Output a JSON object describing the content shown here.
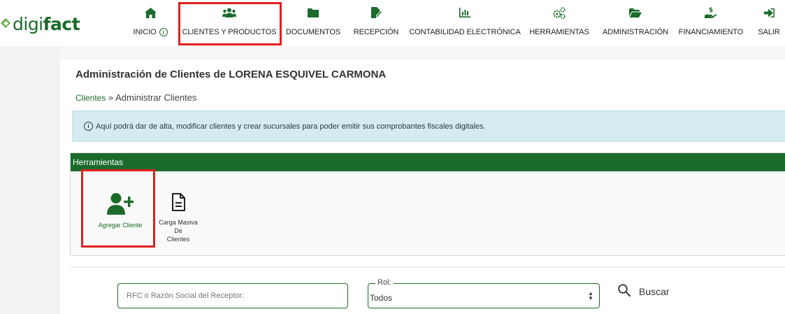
{
  "brand": {
    "part1": "digi",
    "part2": "fact"
  },
  "nav": [
    {
      "id": "inicio",
      "label": "INICIO",
      "icon": "home-icon"
    },
    {
      "id": "clientes",
      "label": "CLIENTES Y PRODUCTOS",
      "icon": "users-icon"
    },
    {
      "id": "documentos",
      "label": "DOCUMENTOS",
      "icon": "folder-icon"
    },
    {
      "id": "recepcion",
      "label": "RECEPCIÓN",
      "icon": "file-signature-icon"
    },
    {
      "id": "contabilidad",
      "label": "CONTABILIDAD ELECTRÓNICA",
      "icon": "chart-icon"
    },
    {
      "id": "herramientas",
      "label": "HERRAMIENTAS",
      "icon": "gears-icon"
    },
    {
      "id": "administracion",
      "label": "ADMINISTRACIÓN",
      "icon": "folder-open-icon"
    },
    {
      "id": "financiamiento",
      "label": "FINANCIAMIENTO",
      "icon": "hand-money-icon"
    },
    {
      "id": "salir",
      "label": "SALIR",
      "icon": "sign-out-icon"
    }
  ],
  "page": {
    "title": "Administración de Clientes de LORENA ESQUIVEL CARMONA",
    "breadcrumb_link": "Clientes",
    "breadcrumb_sep": " » ",
    "breadcrumb_current": "Administrar Clientes",
    "info_text": "Aquí podrá dar de alta, modificar clientes y crear sucursales para poder emitir sus comprobantes fiscales digitales."
  },
  "tools": {
    "header": "Herramientas",
    "add_client": "Agregar Cliente",
    "bulk_line1": "Carga Masiva De",
    "bulk_line2": "Clientes"
  },
  "search": {
    "placeholder": "RFC o Razón Social del Receptor:",
    "role_label": "Rol:",
    "role_value": "Todos",
    "button": "Buscar"
  },
  "colors": {
    "brand_green": "#1b6b2a",
    "highlight_red": "#e02020",
    "info_bg": "#d4ecf0"
  }
}
